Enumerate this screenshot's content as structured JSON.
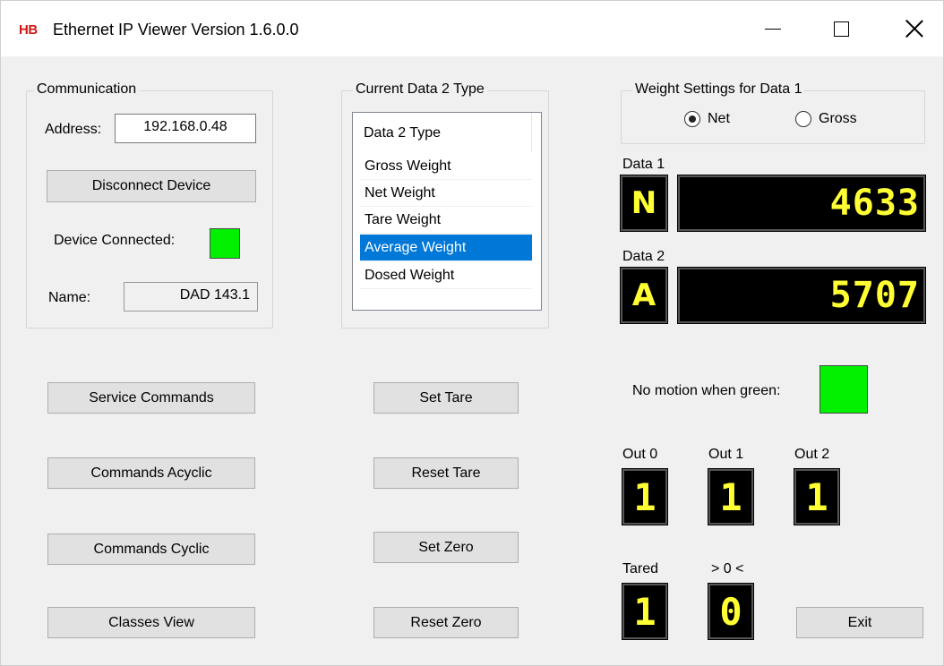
{
  "window": {
    "logo": "HB",
    "title": "Ethernet IP Viewer Version 1.6.0.0"
  },
  "communication": {
    "legend": "Communication",
    "address_label": "Address:",
    "address_value": "192.168.0.48",
    "disconnect_label": "Disconnect Device",
    "connected_label": "Device Connected:",
    "name_label": "Name:",
    "name_value": "DAD 143.1"
  },
  "data2_type": {
    "legend": "Current Data 2 Type",
    "header": "Data 2 Type",
    "items": [
      "Gross Weight",
      "Net Weight",
      "Tare Weight",
      "Average Weight",
      "Dosed Weight"
    ],
    "selected": "Average Weight"
  },
  "weight_settings": {
    "legend": "Weight Settings for Data 1",
    "options": [
      "Net",
      "Gross"
    ],
    "selected": "Net"
  },
  "data1": {
    "label": "Data 1",
    "letter": "N",
    "value": "4633"
  },
  "data2": {
    "label": "Data 2",
    "letter": "A",
    "value": "5707"
  },
  "motion": {
    "label": "No motion when green:"
  },
  "outputs": [
    {
      "label": "Out 0",
      "value": "1"
    },
    {
      "label": "Out 1",
      "value": "1"
    },
    {
      "label": "Out 2",
      "value": "1"
    }
  ],
  "flags": [
    {
      "label": "Tared",
      "value": "1"
    },
    {
      "label": "> 0 <",
      "value": "0"
    }
  ],
  "buttons": {
    "service_commands": "Service Commands",
    "commands_acyclic": "Commands Acyclic",
    "commands_cyclic": "Commands Cyclic",
    "classes_view": "Classes View",
    "set_tare": "Set Tare",
    "reset_tare": "Reset Tare",
    "set_zero": "Set Zero",
    "reset_zero": "Reset Zero",
    "exit": "Exit"
  },
  "colors": {
    "led_on": "#00f000",
    "display_text": "#ffff33",
    "display_bg": "#000000",
    "selection": "#0078d7",
    "logo": "#d11919"
  }
}
